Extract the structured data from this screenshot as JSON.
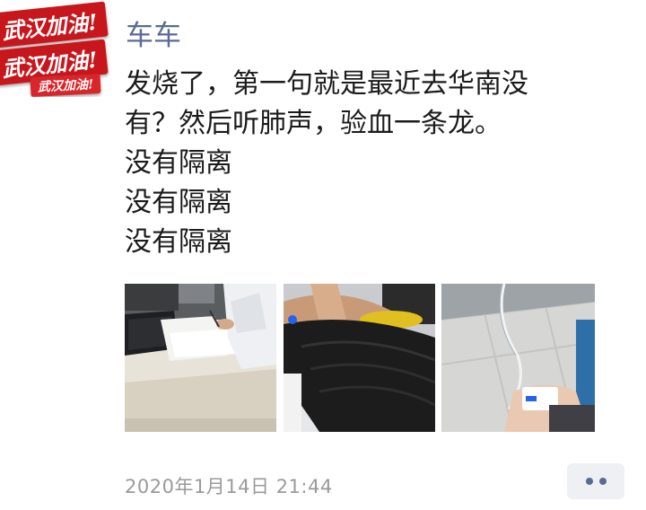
{
  "avatar": {
    "stamp_line1": "武汉加油!",
    "stamp_line2": "武汉加油!",
    "stamp_line3": "武汉加油!"
  },
  "post": {
    "username": "车车",
    "lines": [
      "发烧了，第一句就是最近去华南没",
      "有？然后听肺声，验血一条龙。",
      "没有隔离",
      "没有隔离",
      "没有隔离"
    ],
    "timestamp": "2020年1月14日 21:44"
  },
  "photos": [
    {
      "icon": "photo-doctor-desk"
    },
    {
      "icon": "photo-patient-arm"
    },
    {
      "icon": "photo-iv-drip"
    }
  ],
  "colors": {
    "username": "#5a6b93",
    "text": "#1b1b1b",
    "timestamp": "#9a9a9a",
    "stamp_red": "#c8161d",
    "more_button_bg": "#eef0f4",
    "more_button_dots": "#5b6b90"
  }
}
